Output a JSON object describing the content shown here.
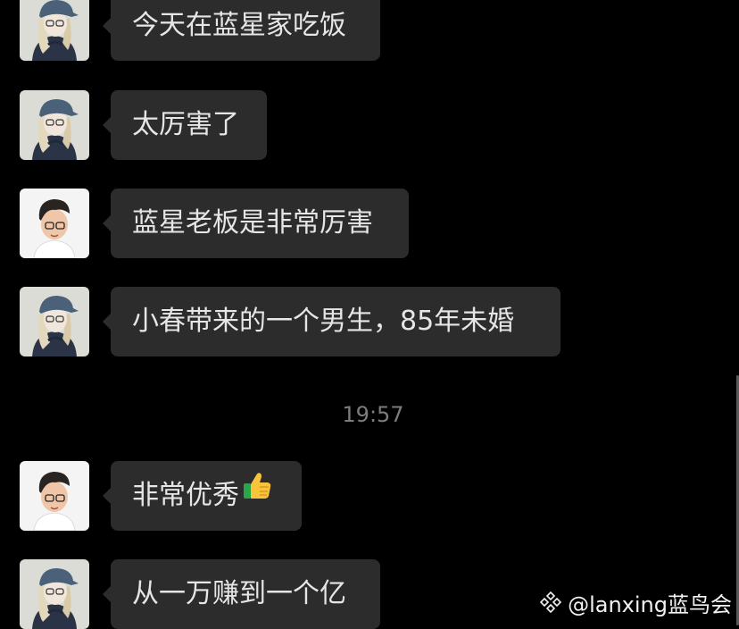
{
  "colors": {
    "background": "#000000",
    "bubble": "#2c2c2c",
    "bubble_text": "#e6e6e6",
    "timestamp": "#7d7d7d"
  },
  "messages_before": [
    {
      "sender": "girl-avatar",
      "text": "今天在蓝星家吃饭"
    },
    {
      "sender": "girl-avatar",
      "text": "太厉害了"
    },
    {
      "sender": "boy-avatar",
      "text": "蓝星老板是非常厉害"
    },
    {
      "sender": "girl-avatar",
      "text": "小春带来的一个男生，85年未婚"
    }
  ],
  "timestamp": "19:57",
  "messages_after": [
    {
      "sender": "boy-avatar",
      "text": "非常优秀",
      "emoji": "thumbs-up-icon"
    },
    {
      "sender": "girl-avatar",
      "text": "从一万赚到一个亿"
    }
  ],
  "watermark": {
    "text": "@lanxing蓝鸟会",
    "icon": "diamond-logo-icon"
  }
}
